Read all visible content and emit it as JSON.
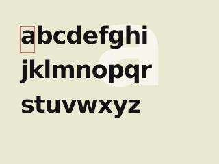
{
  "specimen": {
    "background_glyph": "a",
    "rows": [
      "abcdefghi",
      "jklmnopqr",
      "stuvwxyz"
    ],
    "selected_glyph": "a",
    "colors": {
      "background": "#e9e8d0",
      "glyph": "#141414",
      "background_glyph": "#f7f6ec",
      "selection": "#e0645e"
    }
  }
}
